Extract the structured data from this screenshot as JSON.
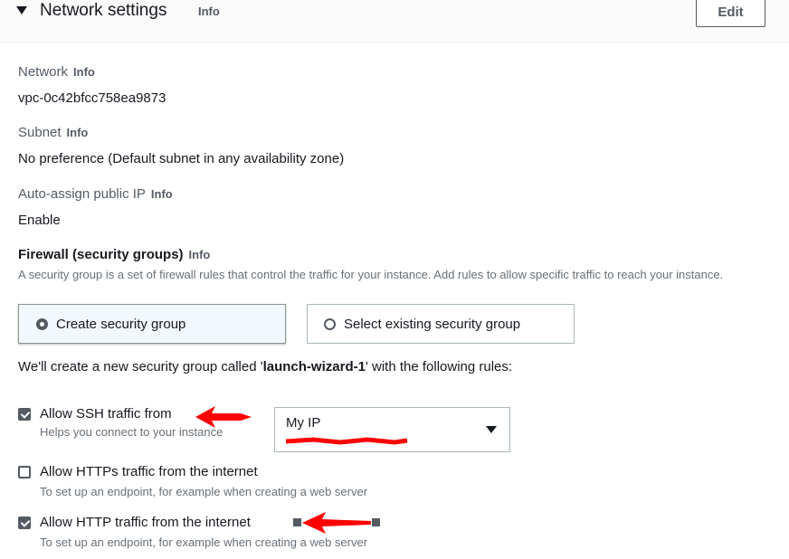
{
  "section": {
    "title": "Network settings",
    "info": "Info",
    "edit_label": "Edit"
  },
  "network": {
    "label": "Network",
    "info": "Info",
    "value": "vpc-0c42bfcc758ea9873"
  },
  "subnet": {
    "label": "Subnet",
    "info": "Info",
    "value": "No preference (Default subnet in any availability zone)"
  },
  "public_ip": {
    "label": "Auto-assign public IP",
    "info": "Info",
    "value": "Enable"
  },
  "firewall": {
    "title": "Firewall (security groups)",
    "info": "Info",
    "description": "A security group is a set of firewall rules that control the traffic for your instance. Add rules to allow specific traffic to reach your instance.",
    "options": [
      {
        "label": "Create security group",
        "selected": true
      },
      {
        "label": "Select existing security group",
        "selected": false
      }
    ],
    "rule_prefix": "We'll create a new security group called '",
    "group_name": "launch-wizard-1",
    "rule_suffix": "' with the following rules:"
  },
  "rules": [
    {
      "label": "Allow SSH traffic from",
      "description": "Helps you connect to your instance",
      "checked": true
    },
    {
      "label": "Allow HTTPs traffic from the internet",
      "description": "To set up an endpoint, for example when creating a web server",
      "checked": false
    },
    {
      "label": "Allow HTTP traffic from the internet",
      "description": "To set up an endpoint, for example when creating a web server",
      "checked": true
    }
  ],
  "ssh_source": {
    "selected": "My IP"
  },
  "colors": {
    "annotation_red": "#ff0000",
    "text_primary": "#16191f",
    "text_secondary": "#687078"
  }
}
